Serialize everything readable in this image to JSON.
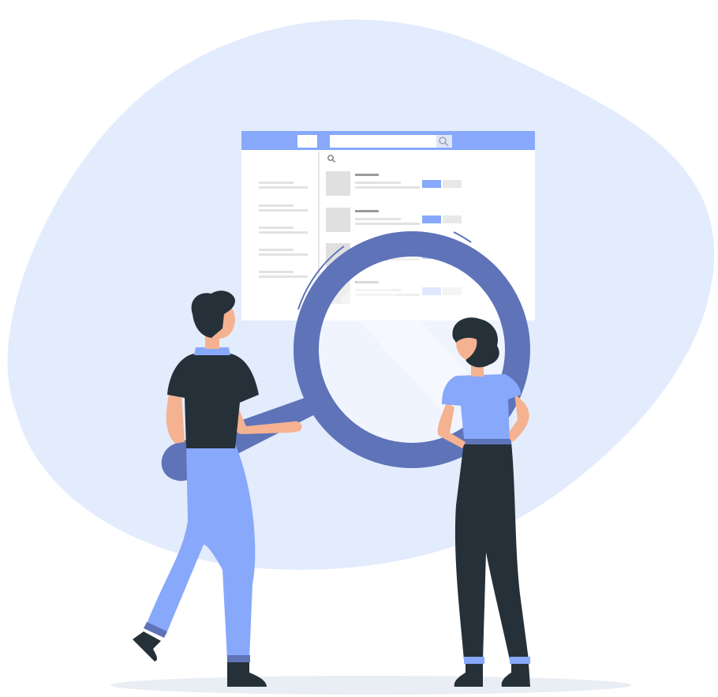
{
  "illustration": {
    "subject": "search-concept",
    "colors": {
      "blob": "#e3ecfd",
      "accent": "#87a8fb",
      "accent_light": "#c9d6fb",
      "magnifier": "#5e73b8",
      "dark": "#263038",
      "skin": "#f5b290",
      "placeholder": "#e0e0e0",
      "title_bar": "#9a9a9a",
      "ground": "#e9edf4"
    },
    "icons": {
      "toolbar_search": "search-icon",
      "panel_search": "search-icon",
      "magnifier": "magnifying-glass"
    },
    "window": {
      "sidebar_items": 5,
      "results": 4
    }
  }
}
